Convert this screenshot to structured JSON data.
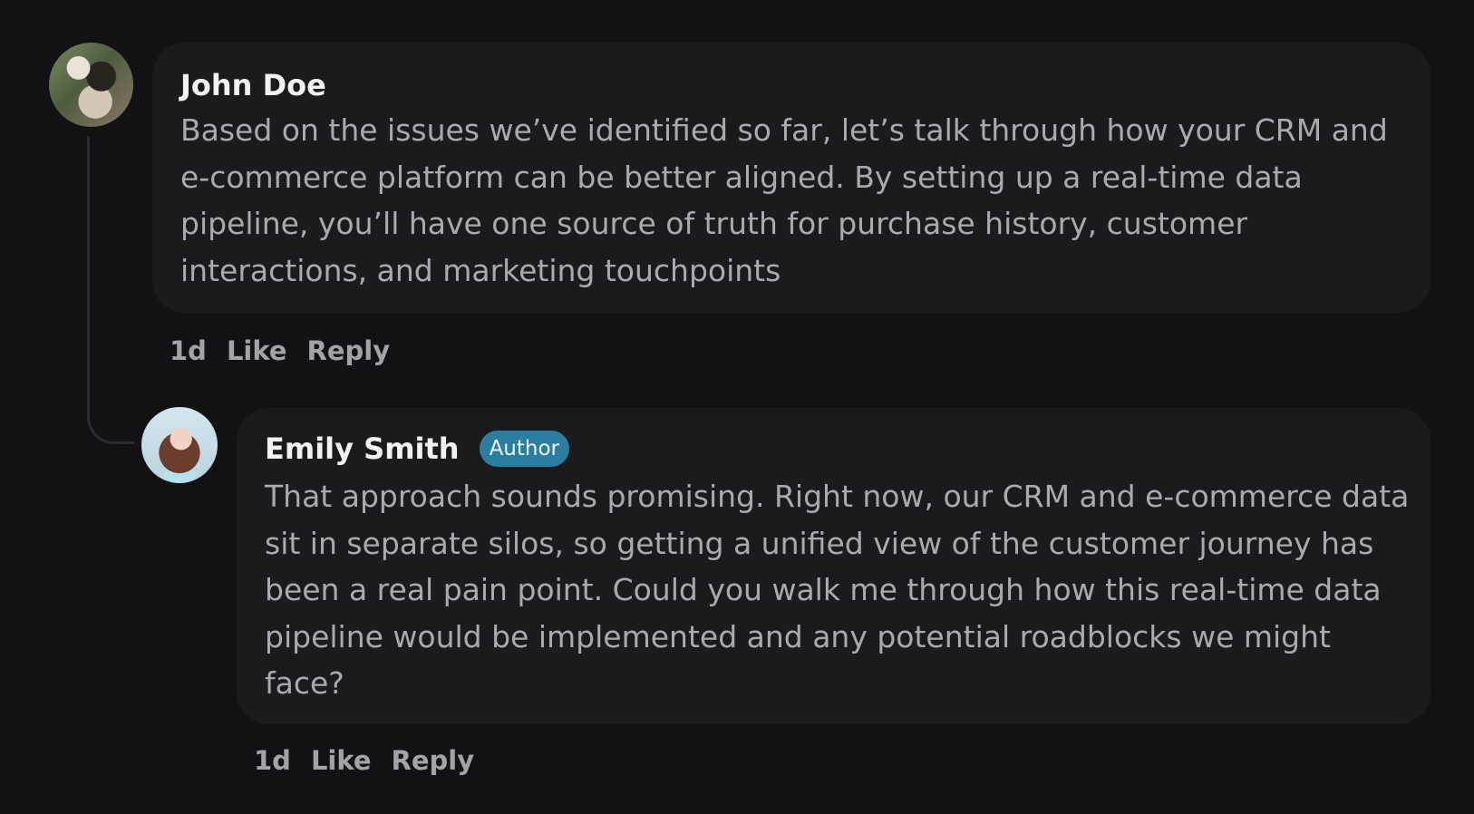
{
  "comments": [
    {
      "author": "John Doe",
      "body": "Based on the issues we’ve identified so far, let’s talk through how your CRM and e-commerce platform can be better aligned. By setting up a real-time data pipeline, you’ll have one source of truth for purchase history, customer interactions, and marketing touchpoints",
      "time": "1d",
      "like_label": "Like",
      "reply_label": "Reply"
    },
    {
      "author": "Emily Smith",
      "badge": "Author",
      "body": "That approach sounds promising. Right now, our CRM and e-commerce data sit in separate silos, so getting a unified view of the customer journey has been a real pain point. Could you walk me through how this real-time data pipeline would be implemented and any potential roadblocks we might face?",
      "time": "1d",
      "like_label": "Like",
      "reply_label": "Reply"
    }
  ],
  "colors": {
    "background": "#121215",
    "card": "#1b1b1e",
    "badge": "#2c7ea0",
    "name_text": "#f2f2f4",
    "body_text": "#a9a9b2"
  }
}
